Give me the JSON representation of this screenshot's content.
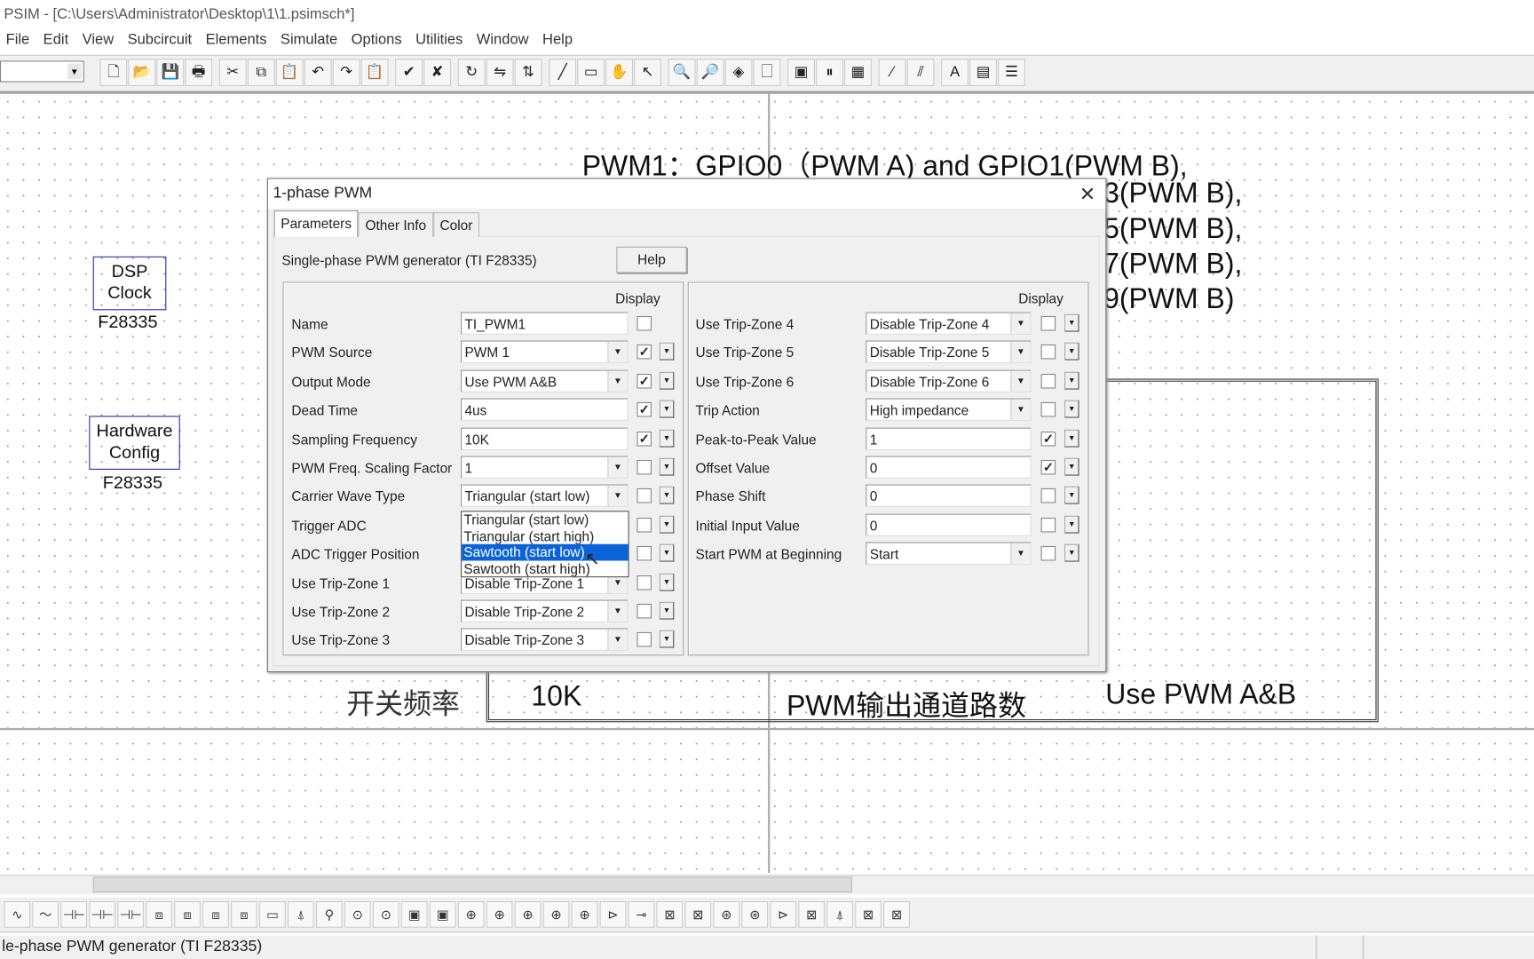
{
  "window": {
    "title": "PSIM - [C:\\Users\\Administrator\\Desktop\\1\\1.psimsch*]"
  },
  "menu": [
    "File",
    "Edit",
    "View",
    "Subcircuit",
    "Elements",
    "Simulate",
    "Options",
    "Utilities",
    "Window",
    "Help"
  ],
  "toolbar": {
    "icons": [
      {
        "name": "new-icon",
        "g": "🗋"
      },
      {
        "name": "open-icon",
        "g": "📂"
      },
      {
        "name": "save-icon",
        "g": "💾"
      },
      {
        "name": "print-icon",
        "g": "🖶"
      },
      {
        "gap": true
      },
      {
        "name": "cut-icon",
        "g": "✂"
      },
      {
        "name": "copy-icon",
        "g": "⧉"
      },
      {
        "name": "paste-icon",
        "g": "📋"
      },
      {
        "name": "undo-icon",
        "g": "↶"
      },
      {
        "name": "redo-icon",
        "g": "↷"
      },
      {
        "name": "clipboard-icon",
        "g": "📋"
      },
      {
        "gap": true
      },
      {
        "name": "check-icon",
        "g": "✔"
      },
      {
        "name": "cross-icon",
        "g": "✘"
      },
      {
        "gap": true
      },
      {
        "name": "rotate-icon",
        "g": "↻"
      },
      {
        "name": "flip-lr-icon",
        "g": "⇋"
      },
      {
        "name": "flip-tb-icon",
        "g": "⇅"
      },
      {
        "gap": true
      },
      {
        "name": "wire-icon",
        "g": "╱"
      },
      {
        "name": "label-icon",
        "g": "▭"
      },
      {
        "name": "pan-hand-icon",
        "g": "✋"
      },
      {
        "name": "select-arrow-icon",
        "g": "↖"
      },
      {
        "gap": true
      },
      {
        "name": "zoom-in-icon",
        "g": "🔍"
      },
      {
        "name": "zoom-out-icon",
        "g": "🔎"
      },
      {
        "name": "zoom-fit-icon",
        "g": "◈"
      },
      {
        "name": "page-icon",
        "g": "🗌"
      },
      {
        "gap": true
      },
      {
        "name": "run-simulation-icon",
        "g": "▣"
      },
      {
        "name": "pause-icon",
        "g": "⏸"
      },
      {
        "name": "simview-icon",
        "g": "▦"
      },
      {
        "gap": true
      },
      {
        "name": "probe-icon",
        "g": "⁄"
      },
      {
        "name": "probe-diff-icon",
        "g": "⫽"
      },
      {
        "gap": true
      },
      {
        "name": "text-icon",
        "g": "A"
      },
      {
        "name": "library-icon",
        "g": "▤"
      },
      {
        "name": "list-icon",
        "g": "☰"
      }
    ]
  },
  "canvas": {
    "pwm_line1": "PWM1：GPIO0（PWM A) and GPIO1(PWM B),",
    "pwm_line2": "3(PWM B),",
    "pwm_line3": "5(PWM B),",
    "pwm_line4": "7(PWM B),",
    "pwm_line5": "9(PWM B)",
    "dsp_clock": {
      "label": "DSP Clock",
      "sub": "F28335"
    },
    "hw_config": {
      "label": "Hardware Config",
      "sub": "F28335"
    },
    "switch_freq_label": "开关频率",
    "switch_freq_value": "10K",
    "pwm_channels_label": "PWM输出通道路数",
    "pwm_channels_value": "Use PWM A&B"
  },
  "element_toolbar": [
    "∿",
    "～",
    "⊣⊢",
    "⊣⊢",
    "⊣⊢",
    "⧈",
    "⧈",
    "⧈",
    "⧈",
    "▭",
    "⍋",
    "⚲",
    "⊙",
    "⊙",
    "▣",
    "▣",
    "⊕",
    "⊕",
    "⊕",
    "⊕",
    "⊕",
    "⊳",
    "⊸",
    "⊠",
    "⊠",
    "⊛",
    "⊛",
    "⊳",
    "⊠",
    "⍋",
    "⊠",
    "⊠"
  ],
  "status": {
    "text": "le-phase PWM generator (TI F28335)"
  },
  "dialog": {
    "title": "1-phase PWM",
    "tabs": [
      "Parameters",
      "Other Info",
      "Color"
    ],
    "description": "Single-phase PWM generator (TI F28335)",
    "help": "Help",
    "display_header": "Display",
    "left": [
      {
        "label": "Name",
        "value": "TI_PWM1",
        "type": "text",
        "checked": false,
        "dd": false
      },
      {
        "label": "PWM Source",
        "value": "PWM 1",
        "type": "combo",
        "checked": true,
        "dd": true
      },
      {
        "label": "Output Mode",
        "value": "Use PWM A&B",
        "type": "combo",
        "checked": true,
        "dd": true
      },
      {
        "label": "Dead Time",
        "value": "4us",
        "type": "text",
        "checked": true,
        "dd": true
      },
      {
        "label": "Sampling Frequency",
        "value": "10K",
        "type": "text",
        "checked": true,
        "dd": true
      },
      {
        "label": "PWM Freq. Scaling Factor",
        "value": "1",
        "type": "combo",
        "checked": false,
        "dd": true
      },
      {
        "label": "Carrier Wave Type",
        "value": "Triangular (start low)",
        "type": "combo",
        "checked": false,
        "dd": true
      },
      {
        "label": "Trigger ADC",
        "value": "",
        "type": "combo",
        "checked": false,
        "dd": true
      },
      {
        "label": "ADC Trigger Position",
        "value": "",
        "type": "text",
        "checked": false,
        "dd": true
      },
      {
        "label": "Use Trip-Zone 1",
        "value": "Disable Trip-Zone 1",
        "type": "combo",
        "checked": false,
        "dd": true
      },
      {
        "label": "Use Trip-Zone 2",
        "value": "Disable Trip-Zone 2",
        "type": "combo",
        "checked": false,
        "dd": true
      },
      {
        "label": "Use Trip-Zone 3",
        "value": "Disable Trip-Zone 3",
        "type": "combo",
        "checked": false,
        "dd": true
      }
    ],
    "right": [
      {
        "label": "Use Trip-Zone 4",
        "value": "Disable Trip-Zone 4",
        "type": "combo",
        "checked": false,
        "dd": true
      },
      {
        "label": "Use Trip-Zone 5",
        "value": "Disable Trip-Zone 5",
        "type": "combo",
        "checked": false,
        "dd": true
      },
      {
        "label": "Use Trip-Zone 6",
        "value": "Disable Trip-Zone 6",
        "type": "combo",
        "checked": false,
        "dd": true
      },
      {
        "label": "Trip Action",
        "value": "High impedance",
        "type": "combo",
        "checked": false,
        "dd": true
      },
      {
        "label": "Peak-to-Peak Value",
        "value": "1",
        "type": "text",
        "checked": true,
        "dd": true
      },
      {
        "label": "Offset Value",
        "value": "0",
        "type": "text",
        "checked": true,
        "dd": true
      },
      {
        "label": "Phase Shift",
        "value": "0",
        "type": "text",
        "checked": false,
        "dd": true
      },
      {
        "label": "Initial Input Value",
        "value": "0",
        "type": "text",
        "checked": false,
        "dd": true
      },
      {
        "label": "Start PWM at Beginning",
        "value": "Start",
        "type": "combo",
        "checked": false,
        "dd": true
      }
    ],
    "carrier_options": [
      "Triangular (start low)",
      "Triangular (start high)",
      "Sawtooth (start low)",
      "Sawtooth (start high)"
    ],
    "carrier_highlighted": "Sawtooth (start low)"
  }
}
